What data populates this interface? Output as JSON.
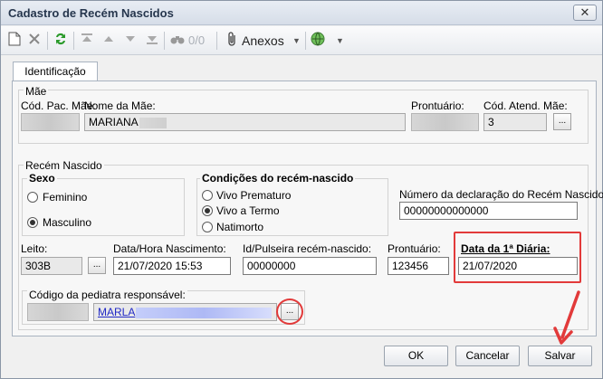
{
  "window": {
    "title": "Cadastro de Recém Nascidos",
    "close_label": "✕"
  },
  "toolbar": {
    "counter": "0/0",
    "anexos_label": "Anexos"
  },
  "tabs": [
    {
      "label": "Identificação"
    }
  ],
  "mae": {
    "group_label": "Mãe",
    "cod_pac_label": "Cód. Pac. Mãe:",
    "nome_label": "Nome da Mãe:",
    "nome_value": "MARIANA",
    "prontuario_label": "Prontuário:",
    "cod_atend_label": "Cód. Atend. Mãe:",
    "cod_atend_value": "3",
    "lookup_label": "..."
  },
  "recem": {
    "group_label": "Recém Nascido",
    "sexo_label": "Sexo",
    "sexo_options": [
      {
        "label": "Feminino",
        "checked": false
      },
      {
        "label": "Masculino",
        "checked": true
      }
    ],
    "cond_label": "Condições do recém-nascido",
    "cond_options": [
      {
        "label": "Vivo Prematuro",
        "checked": false
      },
      {
        "label": "Vivo a Termo",
        "checked": true
      },
      {
        "label": "Natimorto",
        "checked": false
      }
    ],
    "declaracao_label": "Número da declaração do Recém Nascido:",
    "declaracao_value": "00000000000000",
    "leito_label": "Leito:",
    "leito_value": "303B",
    "leito_lookup": "...",
    "datahora_label": "Data/Hora Nascimento:",
    "datahora_value": "21/07/2020 15:53",
    "pulseira_label": "Id/Pulseira recém-nascido:",
    "pulseira_value": "00000000",
    "prontuario_label": "Prontuário:",
    "prontuario_value": "123456",
    "diaria_label": "Data da 1ª Diária:",
    "diaria_value": "21/07/2020",
    "pediatra_label": "Código da pediatra responsável:",
    "pediatra_value": "MARLA",
    "pediatra_lookup": "..."
  },
  "footer": {
    "ok_label": "OK",
    "cancelar_label": "Cancelar",
    "salvar_label": "Salvar"
  },
  "colors": {
    "highlight": "#e23a3a",
    "link": "#2129c6"
  }
}
